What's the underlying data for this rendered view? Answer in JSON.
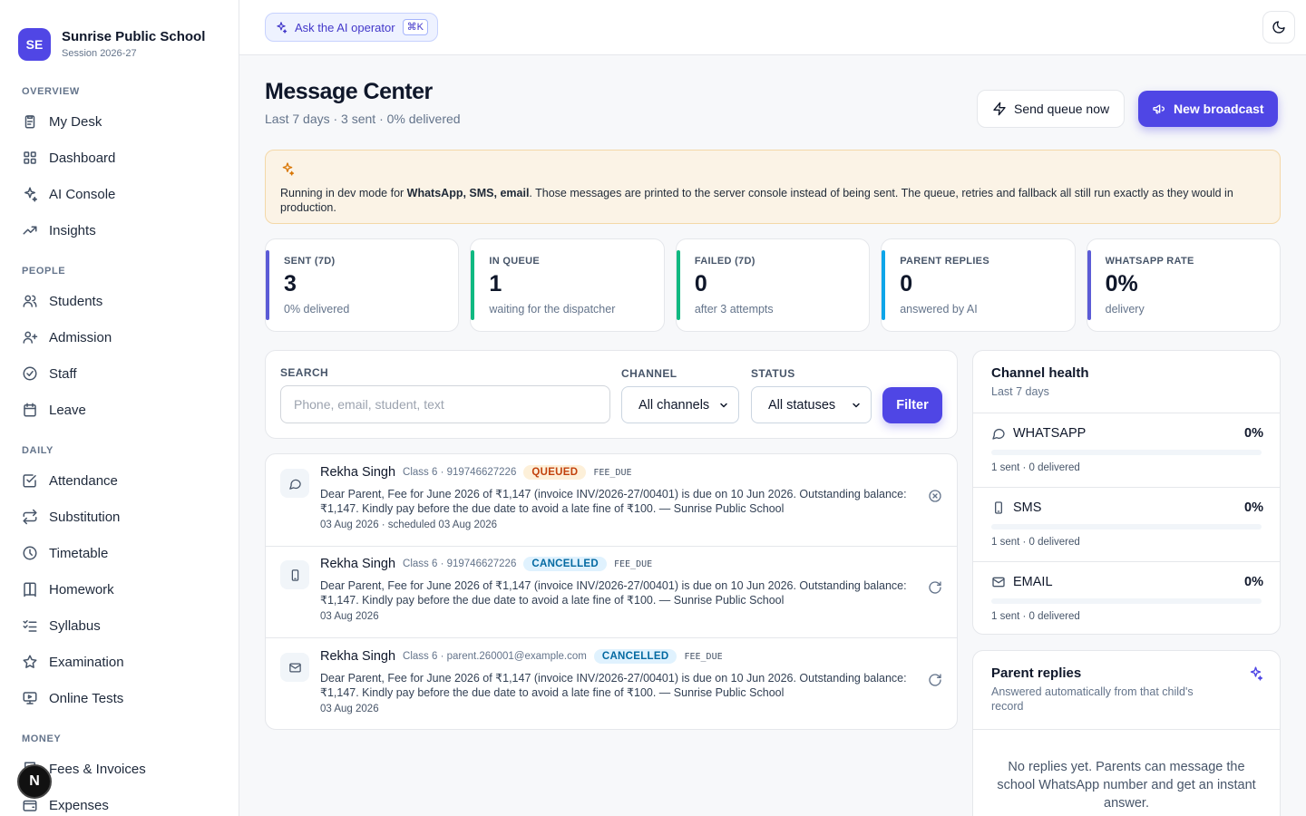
{
  "school": {
    "initials": "SE",
    "name": "Sunrise Public School",
    "session": "Session 2026-27"
  },
  "sidebar": {
    "sections": [
      {
        "title": "OVERVIEW",
        "items": [
          {
            "label": "My Desk",
            "icon": "clipboard-icon"
          },
          {
            "label": "Dashboard",
            "icon": "grid-icon"
          },
          {
            "label": "AI Console",
            "icon": "sparkle-icon"
          },
          {
            "label": "Insights",
            "icon": "trending-up-icon"
          }
        ]
      },
      {
        "title": "PEOPLE",
        "items": [
          {
            "label": "Students",
            "icon": "users-icon"
          },
          {
            "label": "Admission",
            "icon": "user-plus-icon"
          },
          {
            "label": "Staff",
            "icon": "badge-check-icon"
          },
          {
            "label": "Leave",
            "icon": "calendar-icon"
          }
        ]
      },
      {
        "title": "DAILY",
        "items": [
          {
            "label": "Attendance",
            "icon": "check-square-icon"
          },
          {
            "label": "Substitution",
            "icon": "repeat-icon"
          },
          {
            "label": "Timetable",
            "icon": "clock-icon"
          },
          {
            "label": "Homework",
            "icon": "book-icon"
          },
          {
            "label": "Syllabus",
            "icon": "list-checks-icon"
          },
          {
            "label": "Examination",
            "icon": "star-icon"
          },
          {
            "label": "Online Tests",
            "icon": "monitor-icon"
          }
        ]
      },
      {
        "title": "MONEY",
        "items": [
          {
            "label": "Fees & Invoices",
            "icon": "receipt-icon"
          },
          {
            "label": "Expenses",
            "icon": "wallet-icon"
          }
        ]
      }
    ]
  },
  "badge": {
    "letter": "N"
  },
  "topbar": {
    "ask_label": "Ask the AI operator",
    "ask_shortcut": "⌘K"
  },
  "page": {
    "title": "Message Center",
    "subtitle": "Last 7 days · 3 sent · 0% delivered",
    "send_queue_label": "Send queue now",
    "new_broadcast_label": "New broadcast"
  },
  "banner": {
    "prefix": "Running in dev mode for ",
    "channels": "WhatsApp, SMS, email",
    "suffix": ". Those messages are printed to the server console instead of being sent. The queue, retries and fallback all still run exactly as they would in production."
  },
  "stats": [
    {
      "label": "SENT (7D)",
      "value": "3",
      "note": "0% delivered",
      "color": "#5b5bd6"
    },
    {
      "label": "IN QUEUE",
      "value": "1",
      "note": "waiting for the dispatcher",
      "color": "#10b981"
    },
    {
      "label": "FAILED (7D)",
      "value": "0",
      "note": "after 3 attempts",
      "color": "#10b981"
    },
    {
      "label": "PARENT REPLIES",
      "value": "0",
      "note": "answered by AI",
      "color": "#0ea5e9"
    },
    {
      "label": "WHATSAPP RATE",
      "value": "0%",
      "note": "delivery",
      "color": "#5b5bd6"
    }
  ],
  "filters": {
    "search_label": "SEARCH",
    "search_placeholder": "Phone, email, student, text",
    "channel_label": "CHANNEL",
    "channel_value": "All channels",
    "status_label": "STATUS",
    "status_value": "All statuses",
    "filter_button": "Filter"
  },
  "messages": [
    {
      "name": "Rekha Singh",
      "meta": "Class 6 · 919746627226",
      "status": "QUEUED",
      "status_kind": "queued",
      "tag": "FEE_DUE",
      "channel_icon": "chat-bubble-icon",
      "body": "Dear Parent, Fee for June 2026 of ₹1,147 (invoice INV/2026-27/00401) is due on 10 Jun 2026. Outstanding balance: ₹1,147. Kindly pay before the due date to avoid a late fine of ₹100. — Sunrise Public School",
      "time": "03 Aug 2026 · scheduled 03 Aug 2026",
      "action_icon": "cancel-circle-icon"
    },
    {
      "name": "Rekha Singh",
      "meta": "Class 6 · 919746627226",
      "status": "CANCELLED",
      "status_kind": "cancelled",
      "tag": "FEE_DUE",
      "channel_icon": "phone-icon",
      "body": "Dear Parent, Fee for June 2026 of ₹1,147 (invoice INV/2026-27/00401) is due on 10 Jun 2026. Outstanding balance: ₹1,147. Kindly pay before the due date to avoid a late fine of ₹100. — Sunrise Public School",
      "time": "03 Aug 2026",
      "action_icon": "retry-icon"
    },
    {
      "name": "Rekha Singh",
      "meta": "Class 6 · parent.260001@example.com",
      "status": "CANCELLED",
      "status_kind": "cancelled",
      "tag": "FEE_DUE",
      "channel_icon": "mail-icon",
      "body": "Dear Parent, Fee for June 2026 of ₹1,147 (invoice INV/2026-27/00401) is due on 10 Jun 2026. Outstanding balance: ₹1,147. Kindly pay before the due date to avoid a late fine of ₹100. — Sunrise Public School",
      "time": "03 Aug 2026",
      "action_icon": "retry-icon"
    }
  ],
  "health": {
    "title": "Channel health",
    "subtitle": "Last 7 days",
    "channels": [
      {
        "name": "WHATSAPP",
        "pct": "0%",
        "rate": 0,
        "note": "1 sent · 0 delivered",
        "icon": "chat-bubble-icon"
      },
      {
        "name": "SMS",
        "pct": "0%",
        "rate": 0,
        "note": "1 sent · 0 delivered",
        "icon": "phone-icon"
      },
      {
        "name": "EMAIL",
        "pct": "0%",
        "rate": 0,
        "note": "1 sent · 0 delivered",
        "icon": "mail-icon"
      }
    ]
  },
  "replies": {
    "title": "Parent replies",
    "subtitle": "Answered automatically from that child's record",
    "empty": "No replies yet. Parents can message the school WhatsApp number and get an instant answer."
  }
}
